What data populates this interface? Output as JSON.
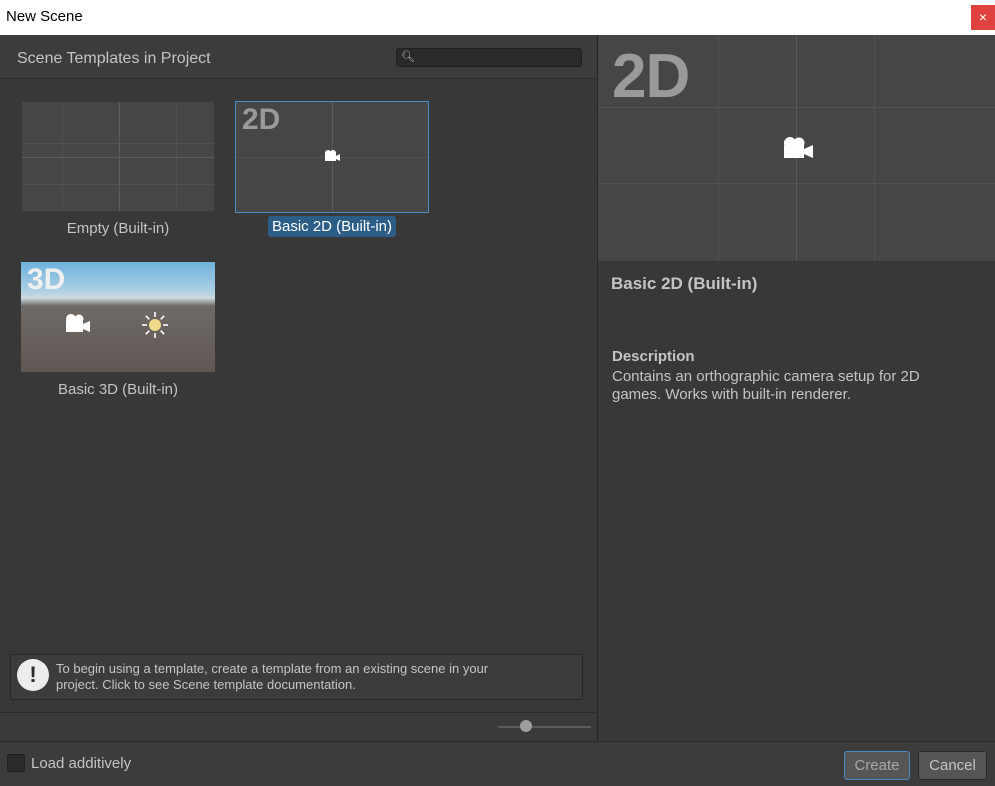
{
  "window": {
    "title": "New Scene",
    "close_glyph": "×"
  },
  "left_panel": {
    "header": "Scene Templates in Project",
    "search": {
      "placeholder": "",
      "value": "",
      "icon": "search-icon"
    }
  },
  "templates": [
    {
      "label": "Empty (Built-in)",
      "badge": "",
      "selected": false
    },
    {
      "label": "Basic 2D (Built-in)",
      "badge": "2D",
      "selected": true
    },
    {
      "label": "Basic 3D (Built-in)",
      "badge": "3D",
      "selected": false
    }
  ],
  "info": {
    "icon": "warning-icon",
    "glyph": "!",
    "line1": "To begin using a template, create a template from an existing scene in your",
    "line2": "project. Click to see Scene template documentation."
  },
  "zoom": {
    "value": 0.3
  },
  "details": {
    "preview_badge": "2D",
    "title": "Basic 2D (Built-in)",
    "description_header": "Description",
    "description": "Contains an orthographic camera setup for 2D games. Works with built-in renderer."
  },
  "footer": {
    "load_additively": "Load additively",
    "load_additively_checked": false,
    "create": "Create",
    "cancel": "Cancel"
  },
  "colors": {
    "panel_bg": "#383838",
    "selection": "#2c5d87",
    "close_button": "#e0433f",
    "focus_outline": "#4a8bc2"
  }
}
